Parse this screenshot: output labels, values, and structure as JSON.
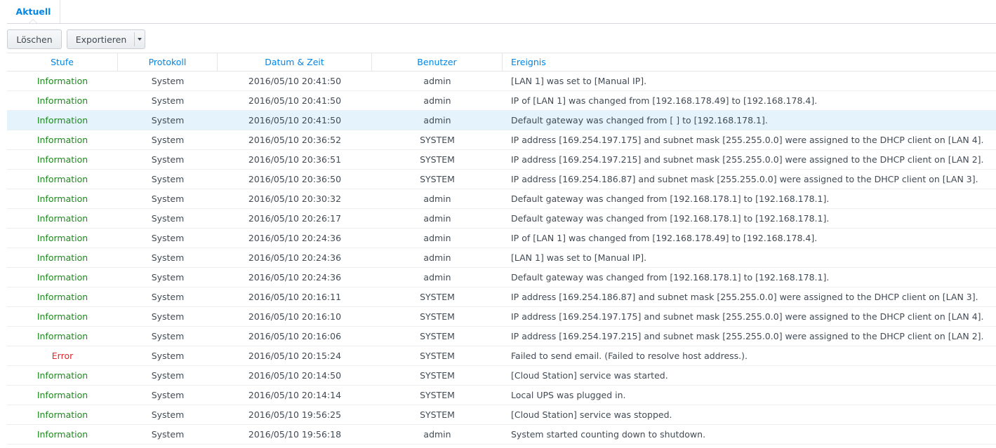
{
  "tabs": {
    "current": "Aktuell"
  },
  "toolbar": {
    "delete_label": "Löschen",
    "export_label": "Exportieren"
  },
  "columns": {
    "level": "Stufe",
    "log": "Protokoll",
    "datetime": "Datum & Zeit",
    "user": "Benutzer",
    "event": "Ereignis"
  },
  "colors": {
    "accent": "#0086e5",
    "info": "#1b8a1b",
    "error": "#e0262b",
    "selected_row": "#e5f3fc"
  },
  "rows": [
    {
      "level": "Information",
      "type": "info",
      "log": "System",
      "datetime": "2016/05/10 20:41:50",
      "user": "admin",
      "event": "[LAN 1] was set to [Manual IP]."
    },
    {
      "level": "Information",
      "type": "info",
      "log": "System",
      "datetime": "2016/05/10 20:41:50",
      "user": "admin",
      "event": "IP of [LAN 1] was changed from [192.168.178.49] to [192.168.178.4]."
    },
    {
      "level": "Information",
      "type": "info",
      "log": "System",
      "datetime": "2016/05/10 20:41:50",
      "user": "admin",
      "event": "Default gateway was changed from [ ] to [192.168.178.1].",
      "selected": true
    },
    {
      "level": "Information",
      "type": "info",
      "log": "System",
      "datetime": "2016/05/10 20:36:52",
      "user": "SYSTEM",
      "event": "IP address [169.254.197.175] and subnet mask [255.255.0.0] were assigned to the DHCP client on [LAN 4]."
    },
    {
      "level": "Information",
      "type": "info",
      "log": "System",
      "datetime": "2016/05/10 20:36:51",
      "user": "SYSTEM",
      "event": "IP address [169.254.197.215] and subnet mask [255.255.0.0] were assigned to the DHCP client on [LAN 2]."
    },
    {
      "level": "Information",
      "type": "info",
      "log": "System",
      "datetime": "2016/05/10 20:36:50",
      "user": "SYSTEM",
      "event": "IP address [169.254.186.87] and subnet mask [255.255.0.0] were assigned to the DHCP client on [LAN 3]."
    },
    {
      "level": "Information",
      "type": "info",
      "log": "System",
      "datetime": "2016/05/10 20:30:32",
      "user": "admin",
      "event": "Default gateway was changed from [192.168.178.1] to [192.168.178.1]."
    },
    {
      "level": "Information",
      "type": "info",
      "log": "System",
      "datetime": "2016/05/10 20:26:17",
      "user": "admin",
      "event": "Default gateway was changed from [192.168.178.1] to [192.168.178.1]."
    },
    {
      "level": "Information",
      "type": "info",
      "log": "System",
      "datetime": "2016/05/10 20:24:36",
      "user": "admin",
      "event": "IP of [LAN 1] was changed from [192.168.178.49] to [192.168.178.4]."
    },
    {
      "level": "Information",
      "type": "info",
      "log": "System",
      "datetime": "2016/05/10 20:24:36",
      "user": "admin",
      "event": "[LAN 1] was set to [Manual IP]."
    },
    {
      "level": "Information",
      "type": "info",
      "log": "System",
      "datetime": "2016/05/10 20:24:36",
      "user": "admin",
      "event": "Default gateway was changed from [192.168.178.1] to [192.168.178.1]."
    },
    {
      "level": "Information",
      "type": "info",
      "log": "System",
      "datetime": "2016/05/10 20:16:11",
      "user": "SYSTEM",
      "event": "IP address [169.254.186.87] and subnet mask [255.255.0.0] were assigned to the DHCP client on [LAN 3]."
    },
    {
      "level": "Information",
      "type": "info",
      "log": "System",
      "datetime": "2016/05/10 20:16:10",
      "user": "SYSTEM",
      "event": "IP address [169.254.197.175] and subnet mask [255.255.0.0] were assigned to the DHCP client on [LAN 4]."
    },
    {
      "level": "Information",
      "type": "info",
      "log": "System",
      "datetime": "2016/05/10 20:16:06",
      "user": "SYSTEM",
      "event": "IP address [169.254.197.215] and subnet mask [255.255.0.0] were assigned to the DHCP client on [LAN 2]."
    },
    {
      "level": "Error",
      "type": "error",
      "log": "System",
      "datetime": "2016/05/10 20:15:24",
      "user": "SYSTEM",
      "event": "Failed to send email. (Failed to resolve host address.)."
    },
    {
      "level": "Information",
      "type": "info",
      "log": "System",
      "datetime": "2016/05/10 20:14:50",
      "user": "SYSTEM",
      "event": "[Cloud Station] service was started."
    },
    {
      "level": "Information",
      "type": "info",
      "log": "System",
      "datetime": "2016/05/10 20:14:14",
      "user": "SYSTEM",
      "event": "Local UPS was plugged in."
    },
    {
      "level": "Information",
      "type": "info",
      "log": "System",
      "datetime": "2016/05/10 19:56:25",
      "user": "SYSTEM",
      "event": "[Cloud Station] service was stopped."
    },
    {
      "level": "Information",
      "type": "info",
      "log": "System",
      "datetime": "2016/05/10 19:56:18",
      "user": "admin",
      "event": "System started counting down to shutdown."
    }
  ]
}
